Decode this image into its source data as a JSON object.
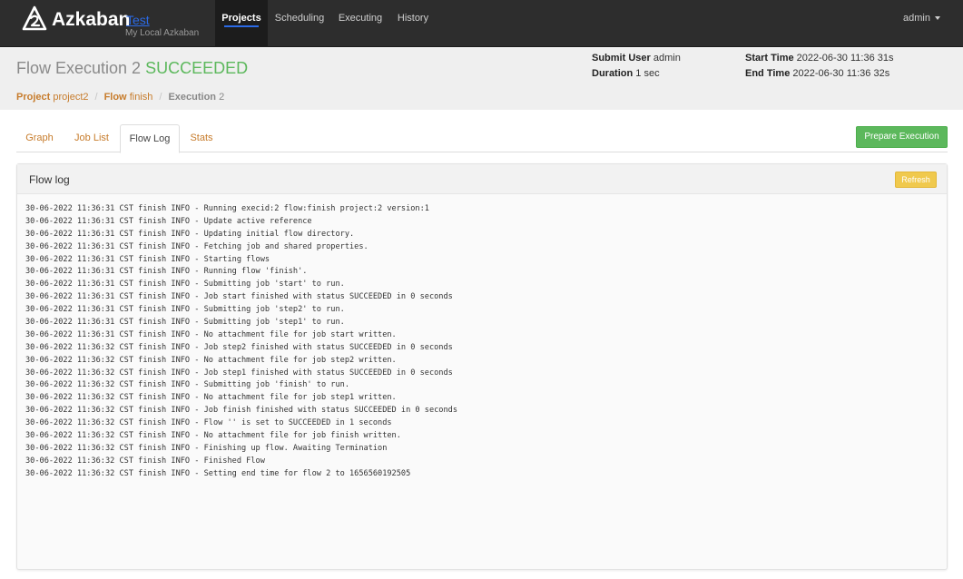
{
  "navbar": {
    "brand": "Azkaban",
    "env": "Test",
    "subtitle": "My Local Azkaban",
    "items": [
      {
        "label": "Projects",
        "active": true
      },
      {
        "label": "Scheduling",
        "active": false
      },
      {
        "label": "Executing",
        "active": false
      },
      {
        "label": "History",
        "active": false
      }
    ],
    "user": "admin"
  },
  "header": {
    "title_prefix": "Flow Execution 2",
    "status": "SUCCEEDED",
    "submit_user_label": "Submit User",
    "submit_user": "admin",
    "duration_label": "Duration",
    "duration": "1 sec",
    "start_time_label": "Start Time",
    "start_time": "2022-06-30 11:36 31s",
    "end_time_label": "End Time",
    "end_time": "2022-06-30 11:36 32s"
  },
  "breadcrumb": {
    "project_label": "Project",
    "project": "project2",
    "flow_label": "Flow",
    "flow": "finish",
    "execution_label": "Execution",
    "execution": "2"
  },
  "tabs": [
    {
      "label": "Graph",
      "active": false
    },
    {
      "label": "Job List",
      "active": false
    },
    {
      "label": "Flow Log",
      "active": true
    },
    {
      "label": "Stats",
      "active": false
    }
  ],
  "actions": {
    "prepare_execution": "Prepare Execution",
    "refresh": "Refresh"
  },
  "panel": {
    "title": "Flow log"
  },
  "log_lines": [
    "30-06-2022 11:36:31 CST finish INFO - Running execid:2 flow:finish project:2 version:1",
    "30-06-2022 11:36:31 CST finish INFO - Update active reference",
    "30-06-2022 11:36:31 CST finish INFO - Updating initial flow directory.",
    "30-06-2022 11:36:31 CST finish INFO - Fetching job and shared properties.",
    "30-06-2022 11:36:31 CST finish INFO - Starting flows",
    "30-06-2022 11:36:31 CST finish INFO - Running flow 'finish'.",
    "30-06-2022 11:36:31 CST finish INFO - Submitting job 'start' to run.",
    "30-06-2022 11:36:31 CST finish INFO - Job start finished with status SUCCEEDED in 0 seconds",
    "30-06-2022 11:36:31 CST finish INFO - Submitting job 'step2' to run.",
    "30-06-2022 11:36:31 CST finish INFO - Submitting job 'step1' to run.",
    "30-06-2022 11:36:31 CST finish INFO - No attachment file for job start written.",
    "30-06-2022 11:36:32 CST finish INFO - Job step2 finished with status SUCCEEDED in 0 seconds",
    "30-06-2022 11:36:32 CST finish INFO - No attachment file for job step2 written.",
    "30-06-2022 11:36:32 CST finish INFO - Job step1 finished with status SUCCEEDED in 0 seconds",
    "30-06-2022 11:36:32 CST finish INFO - Submitting job 'finish' to run.",
    "30-06-2022 11:36:32 CST finish INFO - No attachment file for job step1 written.",
    "30-06-2022 11:36:32 CST finish INFO - Job finish finished with status SUCCEEDED in 0 seconds",
    "30-06-2022 11:36:32 CST finish INFO - Flow '' is set to SUCCEEDED in 1 seconds",
    "30-06-2022 11:36:32 CST finish INFO - No attachment file for job finish written.",
    "30-06-2022 11:36:32 CST finish INFO - Finishing up flow. Awaiting Termination",
    "30-06-2022 11:36:32 CST finish INFO - Finished Flow",
    "30-06-2022 11:36:32 CST finish INFO - Setting end time for flow 2 to 1656560192505"
  ],
  "colors": {
    "navbar_bg": "#2d2d2d",
    "link_orange": "#c77c2c",
    "success_green": "#5cb85c",
    "warning_yellow": "#f0c94d",
    "env_blue": "#2b6ae6"
  },
  "icons": {
    "logo": "azkaban-logo-icon",
    "user_caret": "caret-down-icon"
  }
}
